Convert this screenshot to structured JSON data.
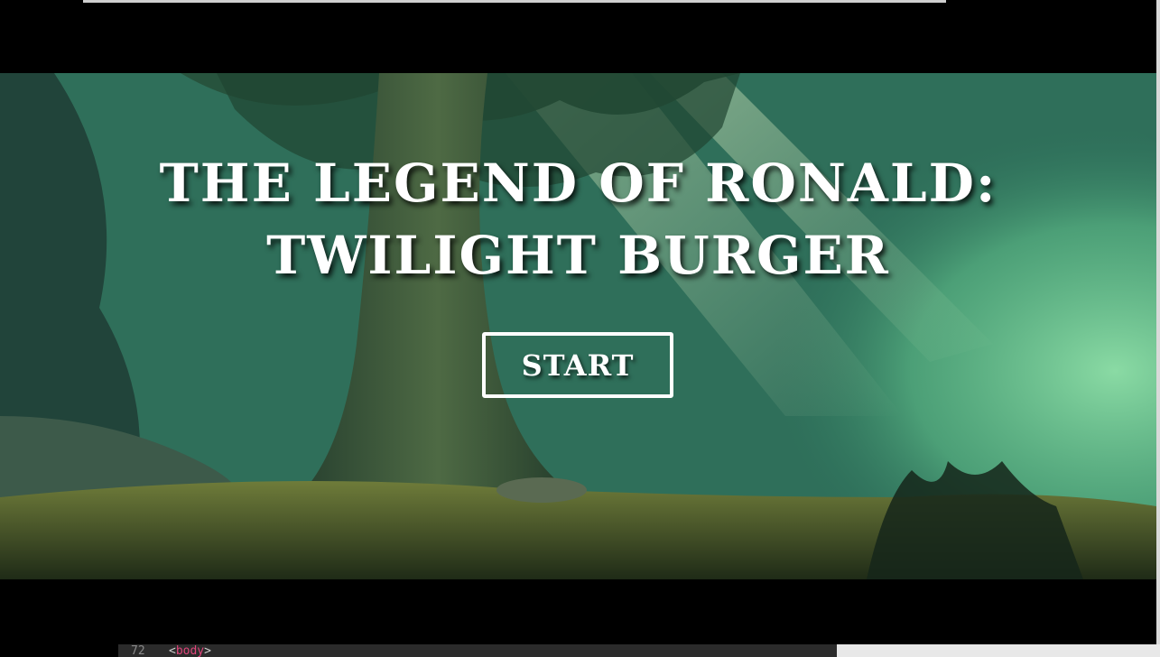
{
  "game": {
    "title_line1": "THE LEGEND OF RONALD:",
    "title_line2": "TWILIGHT BURGER",
    "start_label": "START"
  },
  "editor": {
    "line_number": "72",
    "code_open": "<",
    "code_tag": "body",
    "code_close": ">"
  },
  "colors": {
    "letterbox": "#000000",
    "title_text": "#ffffff",
    "button_border": "#ffffff"
  }
}
